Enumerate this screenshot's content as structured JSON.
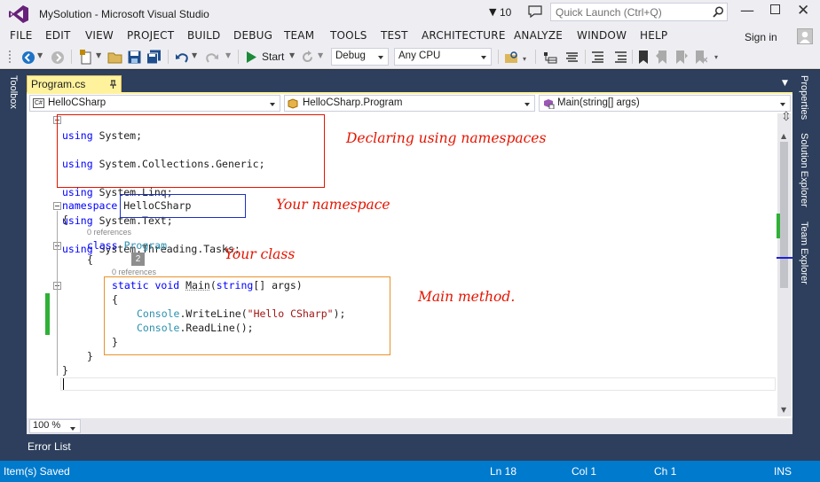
{
  "title_bar": {
    "title": "MySolution - Microsoft Visual Studio",
    "notification_count": "10",
    "quick_launch_placeholder": "Quick Launch (Ctrl+Q)"
  },
  "menu": [
    "FILE",
    "EDIT",
    "VIEW",
    "PROJECT",
    "BUILD",
    "DEBUG",
    "TEAM",
    "TOOLS",
    "TEST",
    "ARCHITECTURE",
    "ANALYZE",
    "WINDOW",
    "HELP"
  ],
  "sign_in": "Sign in",
  "toolbar": {
    "start_label": "Start",
    "configuration": "Debug",
    "platform": "Any CPU"
  },
  "side_tabs": {
    "left": "Toolbox",
    "right": [
      "Properties",
      "Solution Explorer",
      "Team Explorer"
    ]
  },
  "document_tab": {
    "name": "Program.cs"
  },
  "nav_bar": {
    "project": "HelloCSharp",
    "class": "HelloCSharp.Program",
    "member": "Main(string[] args)"
  },
  "code": {
    "using_lines": [
      "System;",
      "System.Collections.Generic;",
      "System.Linq;",
      "System.Text;",
      "System.Threading.Tasks;"
    ],
    "using_kw": "using",
    "namespace_kw": "namespace",
    "namespace_name": "HelloCSharp",
    "open_brace": "{",
    "close_brace": "}",
    "refs_class": "0 references",
    "class_kw": "class",
    "class_name": "Program",
    "badge": "2",
    "refs_method": "0 references",
    "method_kw1": "static",
    "method_kw2": "void",
    "method_name": "Main",
    "method_paren": "(",
    "method_kw3": "string",
    "method_rest": "[] args)",
    "console": "Console",
    "writeline_call": ".WriteLine(",
    "writeline_arg": "\"Hello CSharp\"",
    "writeline_end": ");",
    "readline_call": ".ReadLine();"
  },
  "annotations": {
    "using": "Declaring using namespaces",
    "namespace": "Your namespace",
    "class": "Your class",
    "main": "Main method."
  },
  "annotation_colors": {
    "using": "#e51400",
    "namespace": "#1c2fc4",
    "main": "#e8922a"
  },
  "zoom": "100 %",
  "bottom_panel": {
    "tab": "Error List"
  },
  "status": {
    "message": "Item(s) Saved",
    "line": "Ln 18",
    "col": "Col 1",
    "ch": "Ch 1",
    "mode": "INS"
  }
}
